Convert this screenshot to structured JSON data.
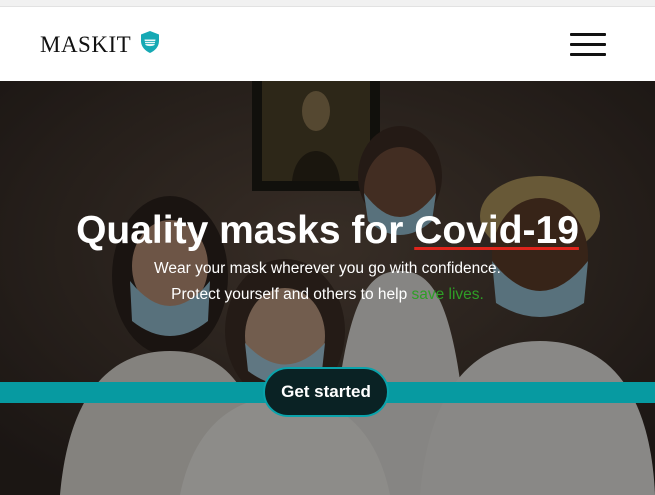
{
  "brand": {
    "name": "MASKIT",
    "icon": "shield-mask-icon"
  },
  "nav": {
    "menu_icon": "hamburger-menu-icon"
  },
  "hero": {
    "title_part1": "Quality masks for ",
    "title_highlight": "Covid-19",
    "line1": "Wear your mask wherever you go with confidence.",
    "line2_part1": "Protect yourself and others to help ",
    "line2_highlight": "save lives.",
    "cta_label": "Get started"
  },
  "colors": {
    "accent_teal": "#079aa1",
    "cta_background": "#0a2224",
    "highlight_green": "#2f9e27",
    "underline_red": "#e0241b"
  }
}
